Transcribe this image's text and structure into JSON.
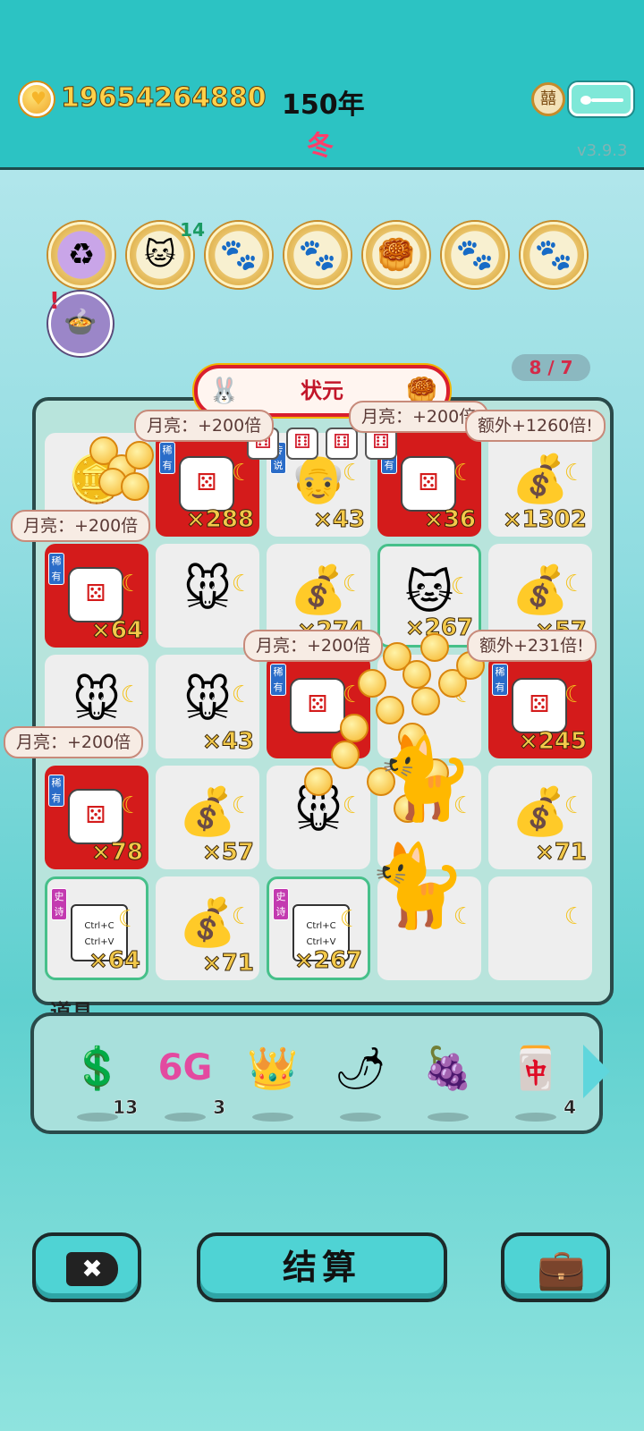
{
  "header": {
    "coins": "19654264880",
    "year": "150年",
    "season": "冬",
    "badge": "囍",
    "version": "v3.9.3"
  },
  "top_icons": [
    {
      "icon": "recycle-icon",
      "glyph": "♻"
    },
    {
      "icon": "cat-fish-icon",
      "glyph": "🐱",
      "count": "14"
    },
    {
      "icon": "cats-icon",
      "glyph": "🐾"
    },
    {
      "icon": "cats-icon",
      "glyph": "🐾"
    },
    {
      "icon": "mooncake-icon",
      "glyph": "🥮"
    },
    {
      "icon": "cats-icon",
      "glyph": "🐾"
    },
    {
      "icon": "cats-icon",
      "glyph": "🐾"
    }
  ],
  "extra_icon": {
    "icon": "bowl-icon",
    "glyph": "🍲",
    "alert": "!"
  },
  "counter": "8 / 7",
  "banner": {
    "title": "状元"
  },
  "board": {
    "cells": [
      {
        "art": "🪙",
        "mult": "",
        "tag": "",
        "style": "plain"
      },
      {
        "art": "die",
        "mult": "×288",
        "tag": "稀有",
        "style": "red"
      },
      {
        "art": "👴",
        "mult": "×43",
        "tag": "传说",
        "style": "plain"
      },
      {
        "art": "die",
        "mult": "×36",
        "tag": "稀有",
        "style": "red"
      },
      {
        "art": "💰",
        "mult": "×1302",
        "tag": "",
        "style": "plain"
      },
      {
        "art": "die",
        "mult": "×64",
        "tag": "稀有",
        "style": "red"
      },
      {
        "art": "🐭",
        "mult": "",
        "tag": "",
        "style": "plain"
      },
      {
        "art": "💰",
        "mult": "×274",
        "tag": "",
        "style": "plain"
      },
      {
        "art": "🐱",
        "mult": "×267",
        "tag": "",
        "style": "green"
      },
      {
        "art": "💰",
        "mult": "×57",
        "tag": "",
        "style": "plain"
      },
      {
        "art": "🐭",
        "mult": "",
        "tag": "",
        "style": "plain"
      },
      {
        "art": "🐭",
        "mult": "×43",
        "tag": "",
        "style": "plain"
      },
      {
        "art": "die",
        "mult": "",
        "tag": "稀有",
        "style": "red"
      },
      {
        "art": "",
        "mult": "",
        "tag": "",
        "style": "plain"
      },
      {
        "art": "die",
        "mult": "×245",
        "tag": "稀有",
        "style": "red"
      },
      {
        "art": "die",
        "mult": "×78",
        "tag": "稀有",
        "style": "red"
      },
      {
        "art": "💰",
        "mult": "×57",
        "tag": "",
        "style": "plain"
      },
      {
        "art": "🐭",
        "mult": "",
        "tag": "",
        "style": "plain"
      },
      {
        "art": "",
        "mult": "",
        "tag": "",
        "style": "plain"
      },
      {
        "art": "💰",
        "mult": "×71",
        "tag": "",
        "style": "plain"
      },
      {
        "art": "ctrl",
        "mult": "×64",
        "tag": "史诗",
        "style": "green"
      },
      {
        "art": "💰",
        "mult": "×71",
        "tag": "",
        "style": "plain"
      },
      {
        "art": "ctrl",
        "mult": "×267",
        "tag": "史诗",
        "style": "green"
      },
      {
        "art": "",
        "mult": "",
        "tag": "",
        "style": "plain"
      },
      {
        "art": "",
        "mult": "",
        "tag": "",
        "style": "plain"
      }
    ],
    "ctrl_text": {
      "line1": "Ctrl+C",
      "line2": "Ctrl+V"
    },
    "bubbles": [
      {
        "text": "月亮：+200倍"
      },
      {
        "text": "月亮：+200倍"
      },
      {
        "text": "额外+1260倍!"
      },
      {
        "text": "月亮：+200倍"
      },
      {
        "text": "月亮：+200倍"
      },
      {
        "text": "额外+231倍!"
      },
      {
        "text": "月亮：+200倍"
      }
    ]
  },
  "items": {
    "label": "道具",
    "list": [
      {
        "icon": "dollar-coin-icon",
        "glyph": "💲",
        "count": "13"
      },
      {
        "icon": "6g-icon",
        "glyph": "6G",
        "count": "3"
      },
      {
        "icon": "crown-icon",
        "glyph": "👑",
        "count": ""
      },
      {
        "icon": "chili-icon",
        "glyph": "🌶",
        "count": ""
      },
      {
        "icon": "lychee-icon",
        "glyph": "🍇",
        "count": ""
      },
      {
        "icon": "cards-icon",
        "glyph": "🀄",
        "count": "4"
      }
    ]
  },
  "buttons": {
    "close_glyph": "✖",
    "settle": "结算",
    "case_glyph": "💼"
  }
}
